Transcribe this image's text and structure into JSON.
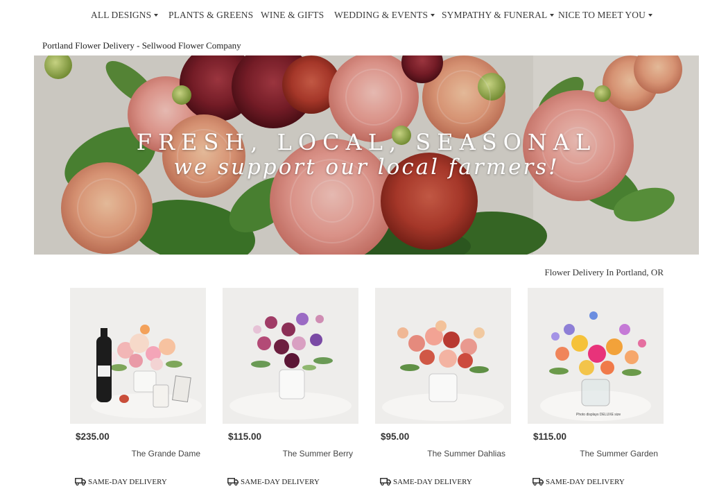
{
  "nav": {
    "items": [
      {
        "label": "ALL DESIGNS",
        "caret": true
      },
      {
        "label": "PLANTS & GREENS",
        "caret": false
      },
      {
        "label": "WINE & GIFTS",
        "caret": false
      },
      {
        "label": "WEDDING & EVENTS",
        "caret": true
      },
      {
        "label": "SYMPATHY & FUNERAL",
        "caret": true
      },
      {
        "label": "NICE TO MEET YOU",
        "caret": true
      }
    ]
  },
  "site_title": "Portland Flower Delivery - Sellwood Flower Company",
  "hero": {
    "headline": "FRESH, LOCAL, SEASONAL",
    "script": "we support our local farmers!"
  },
  "subhead": "Flower Delivery In Portland, OR",
  "products": [
    {
      "price": "$235.00",
      "name": "The Grande Dame",
      "delivery": "SAME-DAY DELIVERY"
    },
    {
      "price": "$115.00",
      "name": "The Summer Berry",
      "delivery": "SAME-DAY DELIVERY"
    },
    {
      "price": "$95.00",
      "name": "The Summer Dahlias",
      "delivery": "SAME-DAY DELIVERY"
    },
    {
      "price": "$115.00",
      "name": "The Summer Garden",
      "delivery": "SAME-DAY DELIVERY",
      "photo_caption": "Photo displays DELUXE size"
    }
  ],
  "icons": {
    "caret": "chevron-down-icon",
    "delivery": "delivery-truck-icon"
  },
  "colors": {
    "nav_text": "#3a3a3a",
    "price_text": "#333333",
    "hero_text": "#ffffff"
  }
}
